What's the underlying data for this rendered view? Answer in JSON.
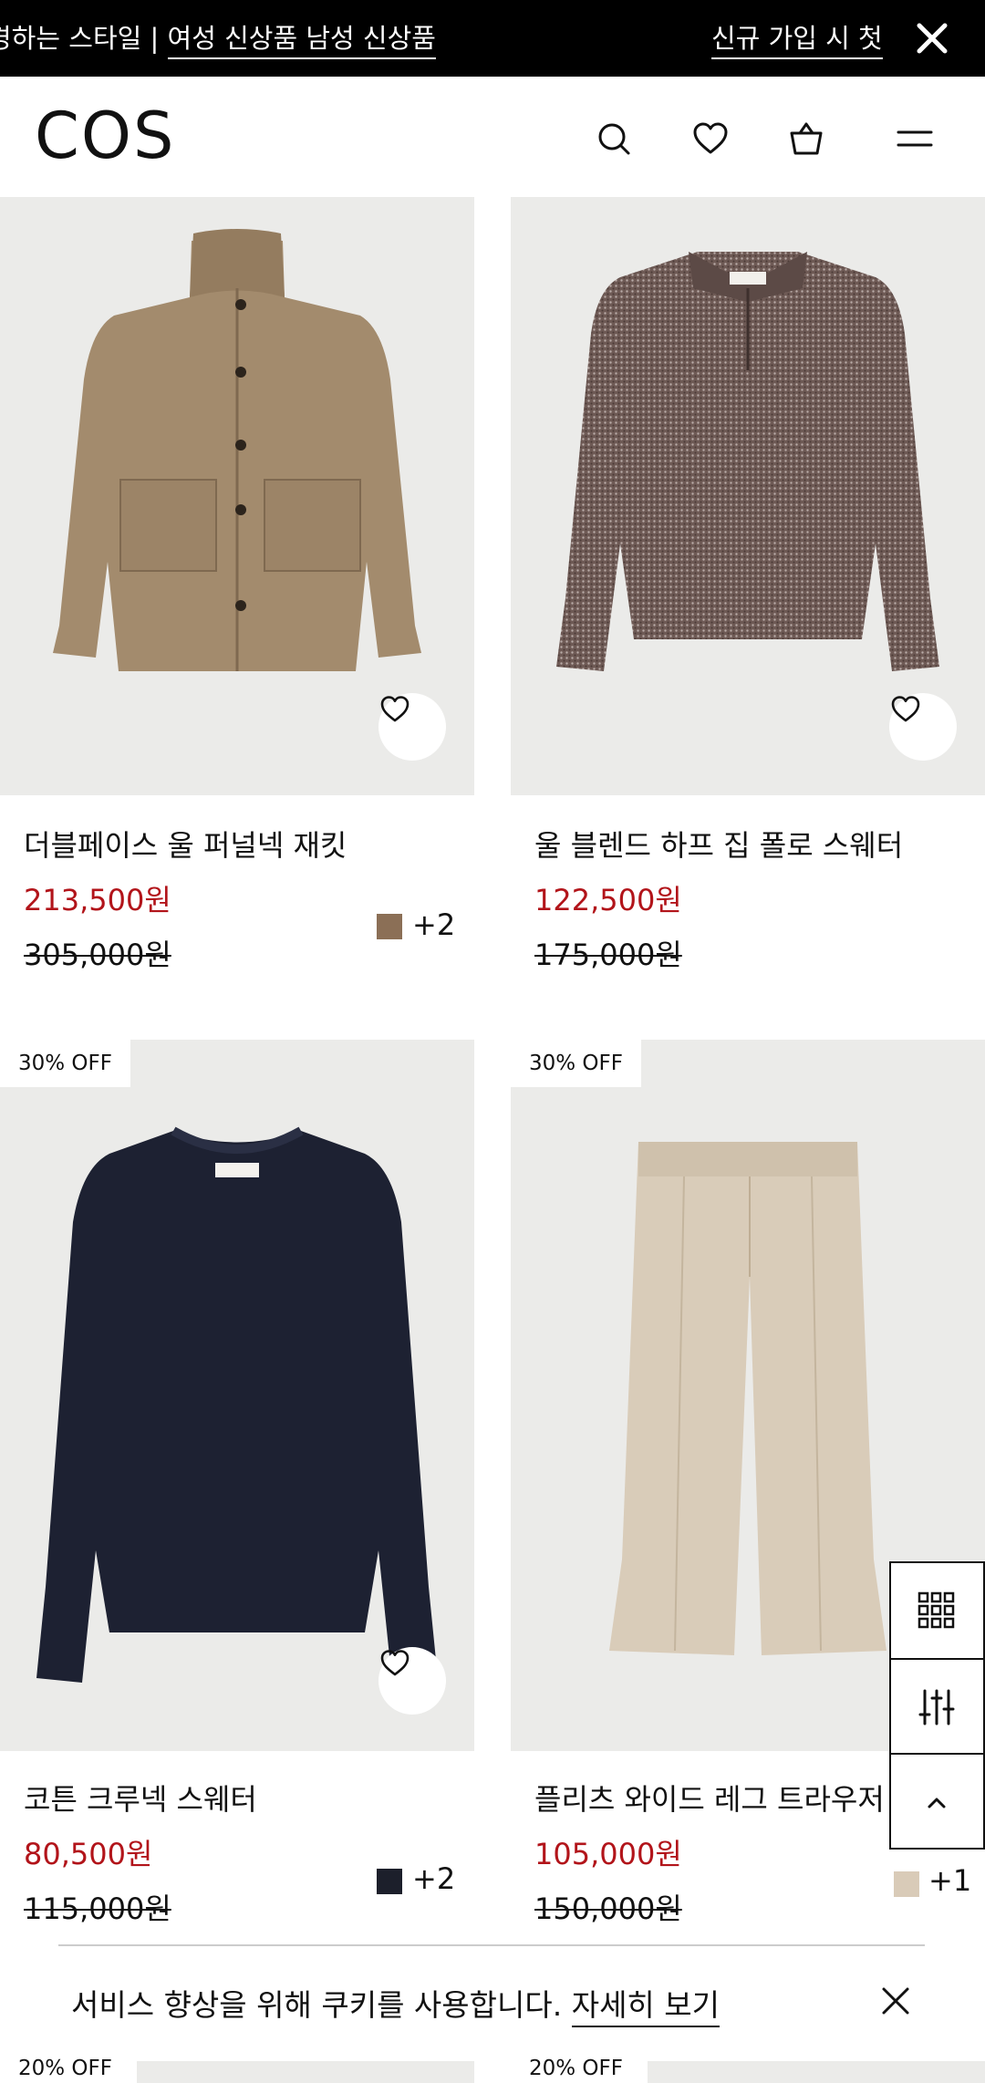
{
  "announcement": {
    "marquee_prefix": "경하는 스타일 | ",
    "marquee_link": "여성 신상품 남성 신상품",
    "signup_text": "신규 가입 시 첫"
  },
  "header": {
    "logo": "COS",
    "icons": [
      "search-icon",
      "heart-icon",
      "bag-icon",
      "menu-icon"
    ]
  },
  "products": [
    {
      "name": "더블페이스 울 퍼널넥 재킷",
      "price": "213,500원",
      "original_price": "305,000원",
      "badge": "",
      "swatch_color": "#8b6f56",
      "more_colors": "+2"
    },
    {
      "name": "울 블렌드 하프 집 폴로 스웨터",
      "price": "122,500원",
      "original_price": "175,000원",
      "badge": "",
      "swatch_color": "",
      "more_colors": ""
    },
    {
      "name": "코튼 크루넥 스웨터",
      "price": "80,500원",
      "original_price": "115,000원",
      "badge": "30% OFF",
      "swatch_color": "#1c1f2b",
      "more_colors": "+2"
    },
    {
      "name": "플리츠 와이드 레그 트라우저",
      "price": "105,000원",
      "original_price": "150,000원",
      "badge": "30% OFF",
      "swatch_color": "#d9cbb8",
      "more_colors": "+1"
    }
  ],
  "next_row_badges": [
    "20% OFF",
    "20% OFF"
  ],
  "floating_controls": [
    "grid-view-icon",
    "filter-icon",
    "scroll-top-icon"
  ],
  "cookie_banner": {
    "message": "서비스 향상을 위해 쿠키를 사용합니다. ",
    "link": "자세히 보기"
  },
  "colors": {
    "sale_price": "#b2141a",
    "announcement_bg": "#000000",
    "image_bg": "#ebebe9"
  }
}
